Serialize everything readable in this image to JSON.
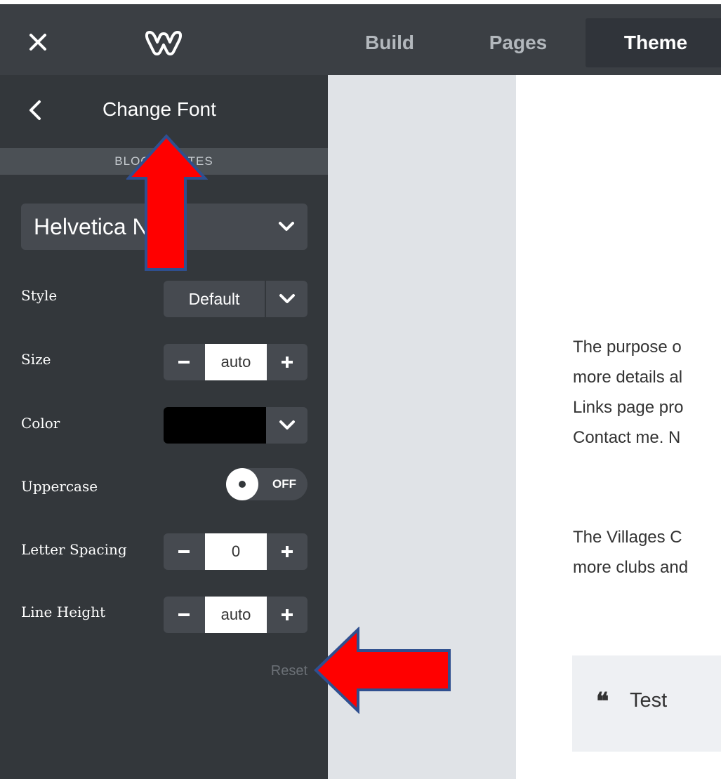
{
  "topbar": {
    "close_icon": "close-icon",
    "logo_icon": "weebly-logo-icon",
    "tabs": [
      {
        "label": "Build",
        "active": false
      },
      {
        "label": "Pages",
        "active": false
      },
      {
        "label": "Theme",
        "active": true
      }
    ]
  },
  "sidebar": {
    "title": "Change Font",
    "section_label": "BLOCKQUOTES",
    "font": {
      "selected": "Helvetica Neue"
    },
    "rows": {
      "style": {
        "label": "Style",
        "value": "Default"
      },
      "size": {
        "label": "Size",
        "value": "auto"
      },
      "color": {
        "label": "Color",
        "value": "#000000"
      },
      "uppercase": {
        "label": "Uppercase",
        "state": "OFF"
      },
      "letter_spacing": {
        "label": "Letter Spacing",
        "value": "0"
      },
      "line_height": {
        "label": "Line Height",
        "value": "auto"
      }
    },
    "reset_label": "Reset"
  },
  "content": {
    "para1": [
      "The purpose o",
      "more details al",
      "Links page pro",
      "Contact me. N"
    ],
    "para2": [
      "The Villages C",
      "more clubs and"
    ],
    "quote": {
      "icon": "quote-icon",
      "text": "Test"
    }
  },
  "annotations": {
    "arrow_color": "#ff0000",
    "arrow_outline": "#2f4f8f"
  }
}
